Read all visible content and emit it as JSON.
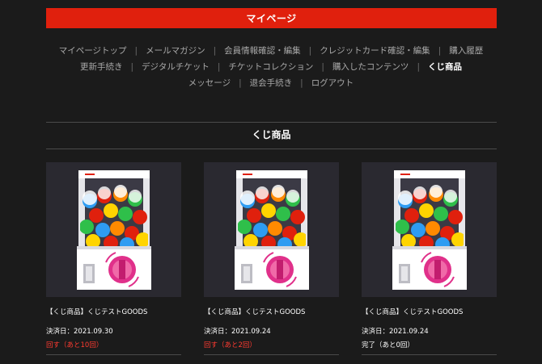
{
  "header": {
    "title": "マイページ"
  },
  "nav": {
    "row1": [
      "マイページトップ",
      "メールマガジン",
      "会員情報確認・編集",
      "クレジットカード確認・編集",
      "購入履歴"
    ],
    "row2": [
      "更新手続き",
      "デジタルチケット",
      "チケットコレクション",
      "購入したコンテンツ",
      "くじ商品"
    ],
    "row3": [
      "メッセージ",
      "退会手続き",
      "ログアウト"
    ],
    "active": "くじ商品"
  },
  "section": {
    "title": "くじ商品"
  },
  "cards": [
    {
      "title": "【くじ商品】くじテストGOODS",
      "date": "決済日：2021.09.30",
      "status": "回す（あと10回）"
    },
    {
      "title": "【くじ商品】くじテストGOODS",
      "date": "決済日：2021.09.24",
      "status": "回す（あと2回）"
    },
    {
      "title": "【くじ商品】くじテストGOODS",
      "date": "決済日：2021.09.24",
      "status": "完了（あと0回）"
    }
  ],
  "colors": {
    "accent": "#e0200d",
    "status_active": "#ff3b30",
    "background": "#1b1b1b"
  },
  "icons": {
    "card_image": "gacha-machine-icon"
  }
}
